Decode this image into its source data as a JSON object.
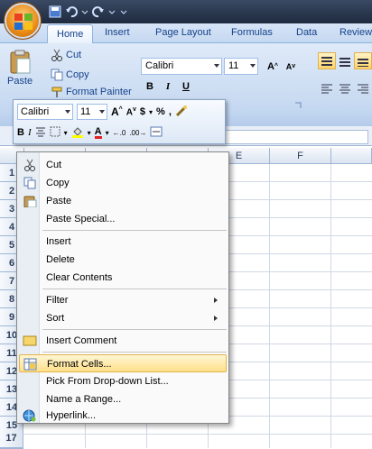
{
  "ribbon_tabs": [
    "Home",
    "Insert",
    "Page Layout",
    "Formulas",
    "Data",
    "Review"
  ],
  "clipboard": {
    "cut": "Cut",
    "copy": "Copy",
    "paste": "Paste",
    "format_painter": "Format Painter"
  },
  "font": {
    "name": "Calibri",
    "size": "11"
  },
  "mini_toolbar": {
    "font": "Calibri",
    "size": "11",
    "currency": "$",
    "percent": "%",
    "comma": ","
  },
  "columns": [
    "E",
    "F"
  ],
  "rows": [
    "1",
    "2",
    "3",
    "4",
    "5",
    "6",
    "7",
    "8",
    "9",
    "10",
    "11",
    "12",
    "13",
    "14",
    "15",
    "16",
    "17"
  ],
  "context_menu": {
    "cut": "Cut",
    "copy": "Copy",
    "paste": "Paste",
    "paste_special": "Paste Special...",
    "insert": "Insert",
    "delete": "Delete",
    "clear_contents": "Clear Contents",
    "filter": "Filter",
    "sort": "Sort",
    "insert_comment": "Insert Comment",
    "format_cells": "Format Cells...",
    "pick_list": "Pick From Drop-down List...",
    "name_range": "Name a Range...",
    "hyperlink": "Hyperlink..."
  },
  "colors": {
    "accent": "#15428b",
    "highlight": "#ffe08a"
  }
}
